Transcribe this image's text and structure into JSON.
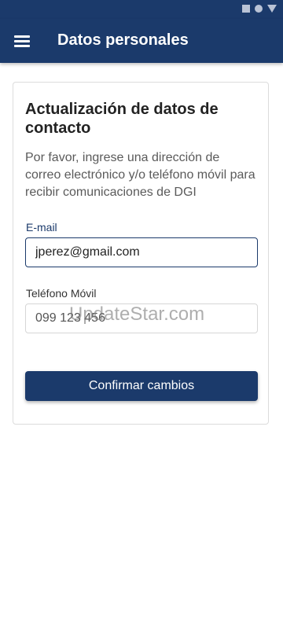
{
  "app_bar": {
    "title": "Datos personales",
    "menu_icon": "hamburger-menu-icon",
    "color": "#1b3a6b"
  },
  "status_bar": {
    "icons": [
      "square-icon",
      "circle-icon",
      "triangle-icon"
    ]
  },
  "card": {
    "title": "Actualización de datos de contacto",
    "description": "Por favor, ingrese una dirección de correo electrónico y/o teléfono móvil para recibir comunicaciones de DGI"
  },
  "form": {
    "email_label": "E-mail",
    "email_value": "jperez@gmail.com",
    "phone_label": "Teléfono Móvil",
    "phone_value": "099 123 456"
  },
  "button": {
    "confirm_label": "Confirmar cambios"
  },
  "watermark": "UpdateStar.com"
}
